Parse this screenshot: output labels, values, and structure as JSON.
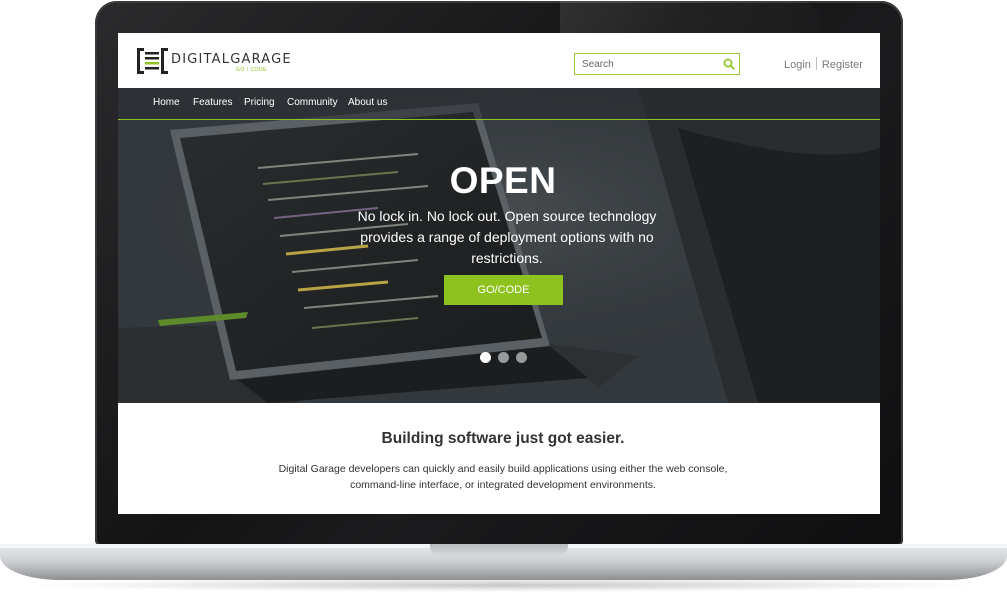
{
  "brand": {
    "name": "DIGITALGARAGE",
    "tagline": "GO / CODE",
    "accent_color": "#8dc21f"
  },
  "search": {
    "placeholder": "Search",
    "icon": "search-icon"
  },
  "auth": {
    "login": "Login",
    "register": "Register"
  },
  "nav": {
    "items": [
      "Home",
      "Features",
      "Pricing",
      "Community",
      "About us"
    ]
  },
  "hero": {
    "title": "OPEN",
    "text": "No lock in. No lock out. Open source technology provides a range of deployment options with no restrictions.",
    "cta": "GO/CODE",
    "slides": 3,
    "active_slide": 1
  },
  "content": {
    "title": "Building software just got easier.",
    "text": "Digital Garage developers can quickly and easily build applications using either the web console, command-line interface, or integrated development environments."
  }
}
